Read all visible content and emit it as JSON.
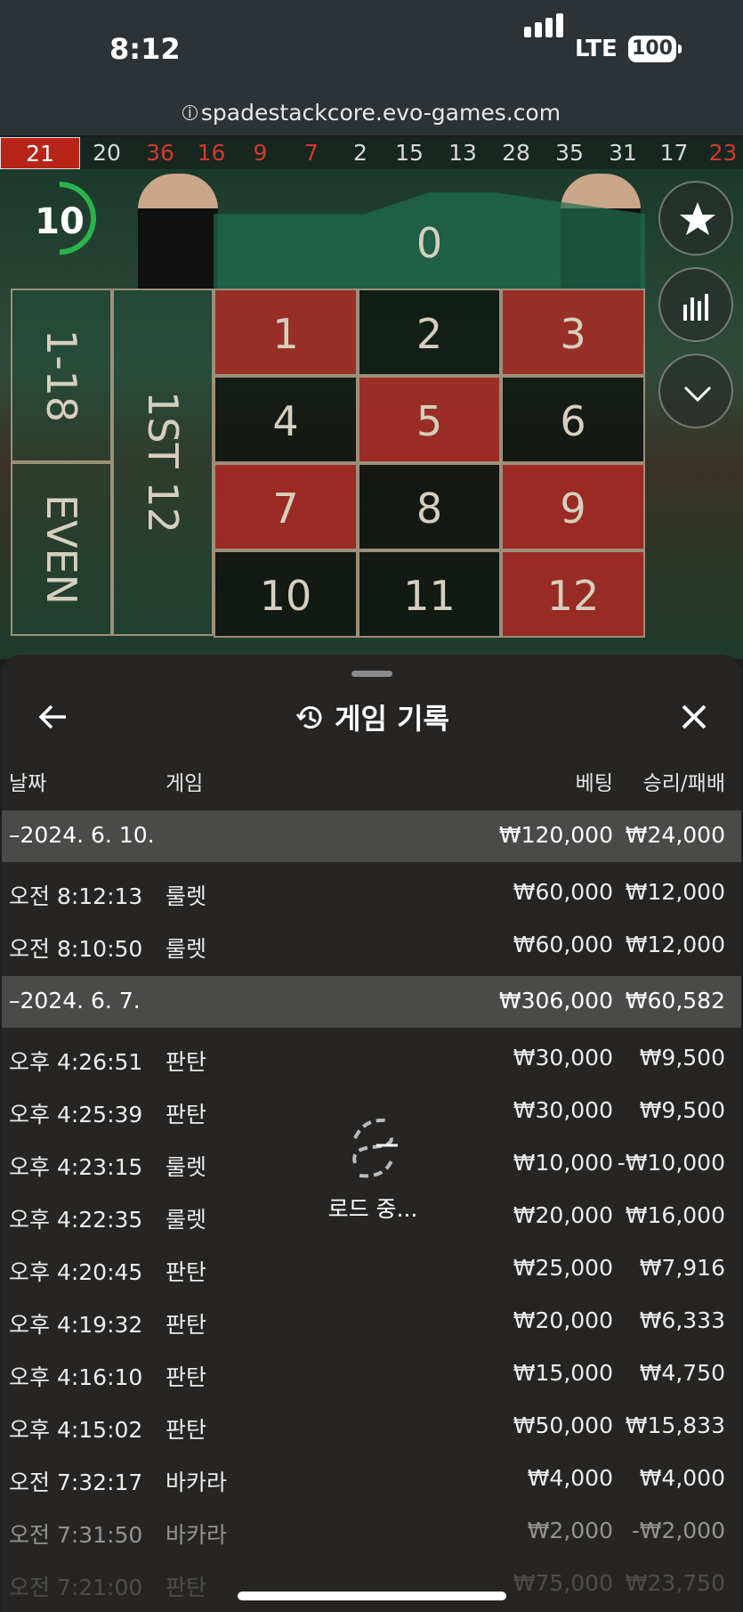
{
  "status_bar": {
    "time": "8:12",
    "network": "LTE",
    "battery": "100"
  },
  "browser": {
    "url": "spadestackcore.evo-games.com"
  },
  "recent_results": [
    {
      "n": "21",
      "c": "red"
    },
    {
      "n": "20",
      "c": "black"
    },
    {
      "n": "36",
      "c": "red"
    },
    {
      "n": "16",
      "c": "red"
    },
    {
      "n": "9",
      "c": "red"
    },
    {
      "n": "7",
      "c": "red"
    },
    {
      "n": "2",
      "c": "black"
    },
    {
      "n": "15",
      "c": "black"
    },
    {
      "n": "13",
      "c": "black"
    },
    {
      "n": "28",
      "c": "black"
    },
    {
      "n": "35",
      "c": "black"
    },
    {
      "n": "31",
      "c": "black"
    },
    {
      "n": "17",
      "c": "black"
    },
    {
      "n": "23",
      "c": "red"
    }
  ],
  "game": {
    "timer": "10",
    "zero": "0",
    "side_low": "1-18",
    "side_even": "EVEN",
    "side_dozen": "1ST 12",
    "numbers": [
      "1",
      "2",
      "3",
      "4",
      "5",
      "6",
      "7",
      "8",
      "9",
      "10",
      "11",
      "12"
    ]
  },
  "panel": {
    "title": "게임 기록",
    "columns": {
      "date": "날짜",
      "game": "게임",
      "bet": "베팅",
      "winloss": "승리/패배"
    },
    "loading": "로드 중...",
    "groups": [
      {
        "date": "–2024. 6. 10.",
        "bet": "₩120,000",
        "winloss": "₩24,000",
        "rows": [
          {
            "time": "오전 8:12:13",
            "game": "룰렛",
            "bet": "₩60,000",
            "winloss": "₩12,000"
          },
          {
            "time": "오전 8:10:50",
            "game": "룰렛",
            "bet": "₩60,000",
            "winloss": "₩12,000"
          }
        ]
      },
      {
        "date": "–2024. 6. 7.",
        "bet": "₩306,000",
        "winloss": "₩60,582",
        "rows": [
          {
            "time": "오후 4:26:51",
            "game": "판탄",
            "bet": "₩30,000",
            "winloss": "₩9,500"
          },
          {
            "time": "오후 4:25:39",
            "game": "판탄",
            "bet": "₩30,000",
            "winloss": "₩9,500"
          },
          {
            "time": "오후 4:23:15",
            "game": "룰렛",
            "bet": "₩10,000",
            "winloss": "-₩10,000"
          },
          {
            "time": "오후 4:22:35",
            "game": "룰렛",
            "bet": "₩20,000",
            "winloss": "₩16,000"
          },
          {
            "time": "오후 4:20:45",
            "game": "판탄",
            "bet": "₩25,000",
            "winloss": "₩7,916"
          },
          {
            "time": "오후 4:19:32",
            "game": "판탄",
            "bet": "₩20,000",
            "winloss": "₩6,333"
          },
          {
            "time": "오후 4:16:10",
            "game": "판탄",
            "bet": "₩15,000",
            "winloss": "₩4,750"
          },
          {
            "time": "오후 4:15:02",
            "game": "판탄",
            "bet": "₩50,000",
            "winloss": "₩15,833"
          },
          {
            "time": "오전 7:32:17",
            "game": "바카라",
            "bet": "₩4,000",
            "winloss": "₩4,000"
          },
          {
            "time": "오전 7:31:50",
            "game": "바카라",
            "bet": "₩2,000",
            "winloss": "-₩2,000"
          },
          {
            "time": "오전 7:21:00",
            "game": "판탄",
            "bet": "₩75,000",
            "winloss": "₩23,750"
          }
        ]
      }
    ]
  },
  "colors": {
    "red": "#b82418",
    "green": "#2bb34a",
    "panel_bg": "#262523",
    "group_bg": "#4a4a48"
  }
}
